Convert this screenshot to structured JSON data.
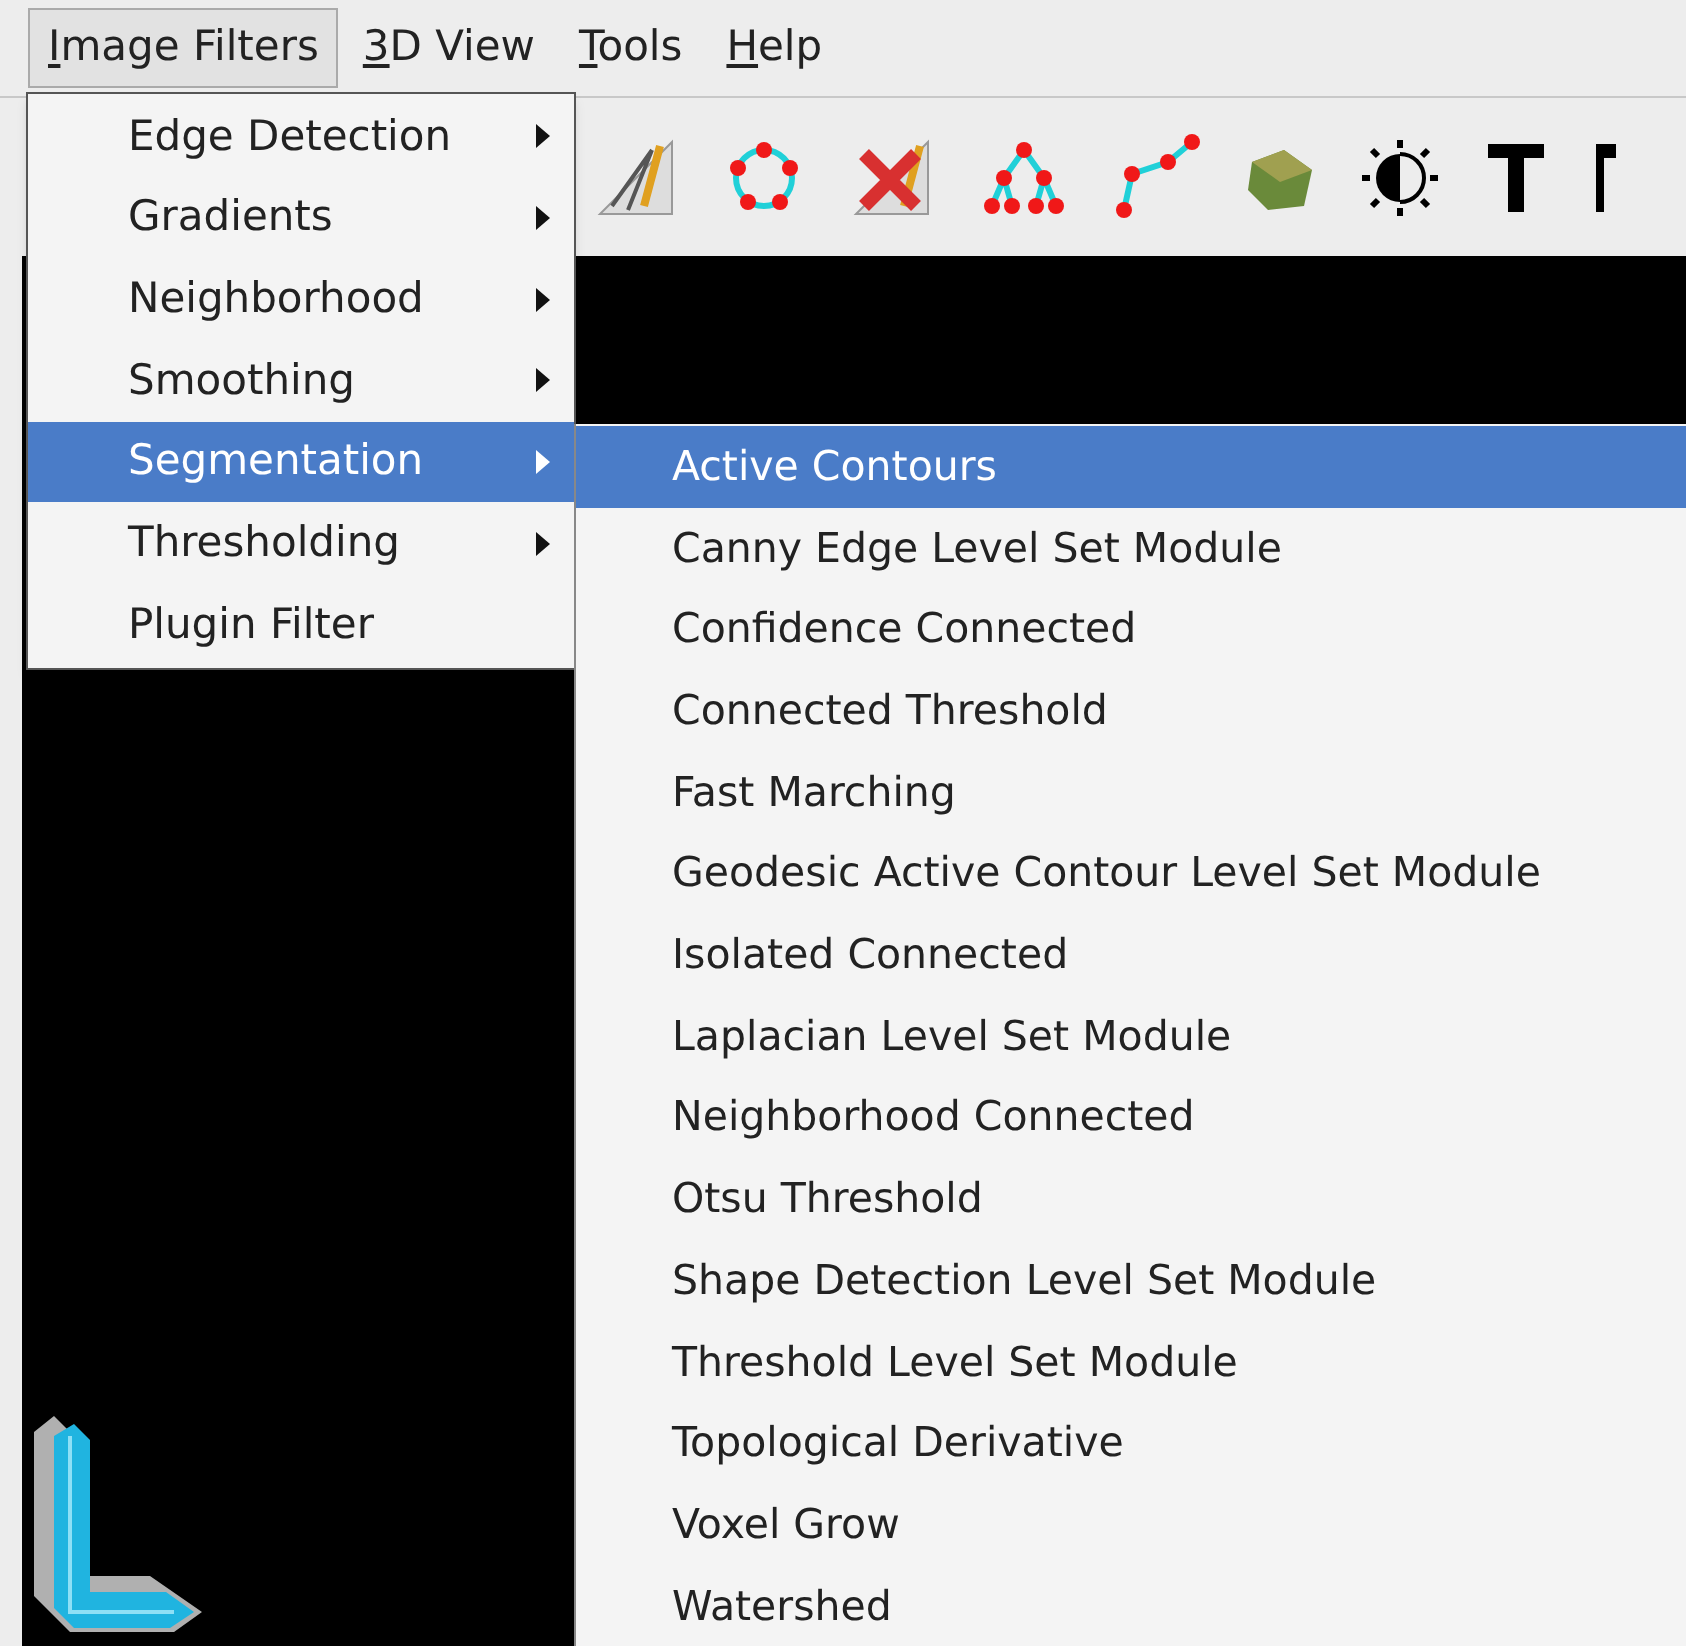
{
  "menu_bar": [
    {
      "label": "Image Filters",
      "selected": true
    },
    {
      "label": "3D View",
      "selected": false
    },
    {
      "label": "Tools",
      "selected": false
    },
    {
      "label": "Help",
      "selected": false
    }
  ],
  "menu": {
    "items": [
      {
        "label": "Edge Detection",
        "submenu": true,
        "selected": false
      },
      {
        "label": "Gradients",
        "submenu": true,
        "selected": false
      },
      {
        "label": "Neighborhood",
        "submenu": true,
        "selected": false
      },
      {
        "label": "Smoothing",
        "submenu": true,
        "selected": false
      },
      {
        "label": "Segmentation",
        "submenu": true,
        "selected": true
      },
      {
        "label": "Thresholding",
        "submenu": true,
        "selected": false
      },
      {
        "label": "Plugin Filter",
        "submenu": false,
        "selected": false
      }
    ]
  },
  "submenu": {
    "items": [
      {
        "label": "Active Contours",
        "selected": true
      },
      {
        "label": "Canny Edge Level Set Module",
        "selected": false
      },
      {
        "label": "Confidence Connected",
        "selected": false
      },
      {
        "label": "Connected Threshold",
        "selected": false
      },
      {
        "label": "Fast Marching",
        "selected": false
      },
      {
        "label": "Geodesic Active Contour Level Set Module",
        "selected": false
      },
      {
        "label": "Isolated Connected",
        "selected": false
      },
      {
        "label": "Laplacian Level Set Module",
        "selected": false
      },
      {
        "label": "Neighborhood Connected",
        "selected": false
      },
      {
        "label": "Otsu Threshold",
        "selected": false
      },
      {
        "label": "Shape Detection Level Set Module",
        "selected": false
      },
      {
        "label": "Threshold Level Set Module",
        "selected": false
      },
      {
        "label": "Topological Derivative",
        "selected": false
      },
      {
        "label": "Voxel Grow",
        "selected": false
      },
      {
        "label": "Watershed",
        "selected": false
      }
    ]
  }
}
